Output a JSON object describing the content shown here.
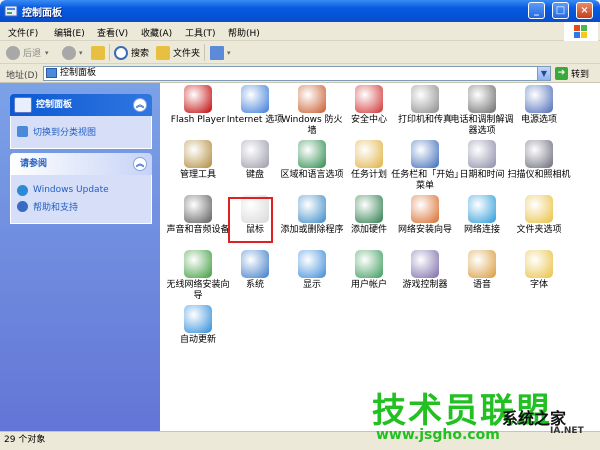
{
  "window": {
    "title": "控制面板",
    "minimize_glyph": "_",
    "maximize_glyph": "□",
    "close_glyph": "×"
  },
  "menu": [
    "文件(F)",
    "编辑(E)",
    "查看(V)",
    "收藏(A)",
    "工具(T)",
    "帮助(H)"
  ],
  "toolbar": {
    "back": "后退",
    "search": "搜索",
    "folders": "文件夹"
  },
  "address": {
    "label": "地址(D)",
    "value": "控制面板",
    "go": "转到"
  },
  "left_pane": {
    "panel1": {
      "title": "控制面板",
      "links": [
        "切换到分类视图"
      ]
    },
    "panel2": {
      "title": "请参阅",
      "links": [
        "Windows Update",
        "帮助和支持"
      ]
    }
  },
  "items": [
    {
      "label": "Flash Player",
      "icon": "flash-icon",
      "color": "#c00000"
    },
    {
      "label": "Internet 选项",
      "icon": "internet-options-icon",
      "color": "#3a7ad8"
    },
    {
      "label": "Windows 防火墙",
      "icon": "firewall-icon",
      "color": "#c85a2a"
    },
    {
      "label": "安全中心",
      "icon": "security-center-icon",
      "color": "#d03030"
    },
    {
      "label": "打印机和传真",
      "icon": "printer-icon",
      "color": "#8a8a8a"
    },
    {
      "label": "电话和调制解调器选项",
      "icon": "phone-modem-icon",
      "color": "#6a6a6a"
    },
    {
      "label": "电源选项",
      "icon": "power-icon",
      "color": "#4a6ab8"
    },
    {
      "label": "管理工具",
      "icon": "admin-tools-icon",
      "color": "#b08a3a"
    },
    {
      "label": "键盘",
      "icon": "keyboard-icon",
      "color": "#9a9aaa"
    },
    {
      "label": "区域和语言选项",
      "icon": "region-language-icon",
      "color": "#2a8a4a"
    },
    {
      "label": "任务计划",
      "icon": "scheduled-tasks-icon",
      "color": "#e0b040"
    },
    {
      "label": "任务栏和「开始」菜单",
      "icon": "taskbar-icon",
      "color": "#3a6ab8"
    },
    {
      "label": "日期和时间",
      "icon": "datetime-icon",
      "color": "#8a8aa8"
    },
    {
      "label": "扫描仪和照相机",
      "icon": "scanner-camera-icon",
      "color": "#6a6a7a"
    },
    {
      "label": "声音和音频设备",
      "icon": "sound-icon",
      "color": "#5a5a5a"
    },
    {
      "label": "鼠标",
      "icon": "mouse-icon",
      "color": "#d8d8d8"
    },
    {
      "label": "添加或删除程序",
      "icon": "add-remove-icon",
      "color": "#3a8ac8"
    },
    {
      "label": "添加硬件",
      "icon": "add-hardware-icon",
      "color": "#2a7a4a"
    },
    {
      "label": "网络安装向导",
      "icon": "network-setup-icon",
      "color": "#d86a2a"
    },
    {
      "label": "网络连接",
      "icon": "network-connections-icon",
      "color": "#2a9ad8"
    },
    {
      "label": "文件夹选项",
      "icon": "folder-options-icon",
      "color": "#e8c040"
    },
    {
      "label": "无线网络安装向导",
      "icon": "wireless-icon",
      "color": "#3a9a3a"
    },
    {
      "label": "系统",
      "icon": "system-icon",
      "color": "#3a7ac8"
    },
    {
      "label": "显示",
      "icon": "display-icon",
      "color": "#3a8ad8"
    },
    {
      "label": "用户帐户",
      "icon": "user-accounts-icon",
      "color": "#3a9a5a"
    },
    {
      "label": "游戏控制器",
      "icon": "game-controller-icon",
      "color": "#7a6aa8"
    },
    {
      "label": "语音",
      "icon": "speech-icon",
      "color": "#d89a3a"
    },
    {
      "label": "字体",
      "icon": "fonts-icon",
      "color": "#e8c040"
    },
    {
      "label": "自动更新",
      "icon": "auto-update-icon",
      "color": "#2a8ad8"
    }
  ],
  "status": "29 个对象",
  "watermark": {
    "big": "技术员联盟",
    "url": "www.jsgho.com",
    "tag": "系统之家",
    "tag2": "IA.NET"
  }
}
